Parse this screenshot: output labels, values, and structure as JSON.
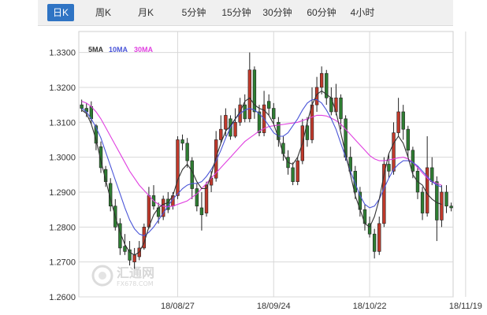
{
  "tabs": [
    {
      "label": "日K",
      "active": true
    },
    {
      "label": "周K",
      "active": false
    },
    {
      "label": "月K",
      "active": false
    },
    {
      "label": "5分钟",
      "active": false
    },
    {
      "label": "15分钟",
      "active": false
    },
    {
      "label": "30分钟",
      "active": false
    },
    {
      "label": "60分钟",
      "active": false
    },
    {
      "label": "4小时",
      "active": false
    }
  ],
  "colors": {
    "up": "#c0392b",
    "down": "#2e7d32",
    "ma5": "#333333",
    "ma10": "#4a55d8",
    "ma30": "#e040e0",
    "grid": "#d8d8d8",
    "tab_active": "#2f74c4"
  },
  "watermark": {
    "name": "汇通网",
    "url": "FX678.COM"
  },
  "chart_data": {
    "type": "candlestick",
    "title": "",
    "legend": [
      {
        "label": "5MA",
        "color": "#333333"
      },
      {
        "label": "10MA",
        "color": "#4a55d8"
      },
      {
        "label": "30MA",
        "color": "#e040e0"
      }
    ],
    "legend_placement": "top-left",
    "grid": true,
    "ylim": [
      1.26,
      1.336
    ],
    "y_ticks": [
      "1.3300",
      "1.3200",
      "1.3100",
      "1.3000",
      "1.2900",
      "1.2800",
      "1.2700",
      "1.2600"
    ],
    "x_ticks": [
      {
        "label": "18/08/27",
        "index": 20
      },
      {
        "label": "18/09/24",
        "index": 40
      },
      {
        "label": "18/10/22",
        "index": 60
      },
      {
        "label": "18/11/19",
        "index": 80
      }
    ],
    "candles": [
      [
        1.315,
        1.314,
        1.3165,
        1.313
      ],
      [
        1.314,
        1.313,
        1.3155,
        1.3115
      ],
      [
        1.3145,
        1.311,
        1.316,
        1.3095
      ],
      [
        1.309,
        1.304,
        1.3095,
        1.302
      ],
      [
        1.303,
        1.297,
        1.3045,
        1.2955
      ],
      [
        1.2965,
        1.293,
        1.2975,
        1.2915
      ],
      [
        1.2925,
        1.286,
        1.294,
        1.2845
      ],
      [
        1.286,
        1.28,
        1.288,
        1.279
      ],
      [
        1.281,
        1.274,
        1.2825,
        1.272
      ],
      [
        1.2745,
        1.273,
        1.278,
        1.272
      ],
      [
        1.2735,
        1.2705,
        1.276,
        1.269
      ],
      [
        1.27,
        1.272,
        1.274,
        1.268
      ],
      [
        1.2715,
        1.274,
        1.276,
        1.2705
      ],
      [
        1.274,
        1.28,
        1.281,
        1.2735
      ],
      [
        1.28,
        1.289,
        1.2915,
        1.2795
      ],
      [
        1.289,
        1.286,
        1.292,
        1.285
      ],
      [
        1.2855,
        1.283,
        1.287,
        1.281
      ],
      [
        1.283,
        1.288,
        1.289,
        1.282
      ],
      [
        1.288,
        1.285,
        1.29,
        1.284
      ],
      [
        1.286,
        1.289,
        1.29,
        1.285
      ],
      [
        1.289,
        1.305,
        1.306,
        1.288
      ],
      [
        1.305,
        1.304,
        1.3065,
        1.302
      ],
      [
        1.304,
        1.299,
        1.3055,
        1.297
      ],
      [
        1.299,
        1.291,
        1.3,
        1.288
      ],
      [
        1.291,
        1.286,
        1.2925,
        1.2845
      ],
      [
        1.2855,
        1.2835,
        1.29,
        1.279
      ],
      [
        1.284,
        1.292,
        1.293,
        1.283
      ],
      [
        1.292,
        1.294,
        1.296,
        1.29
      ],
      [
        1.294,
        1.305,
        1.3075,
        1.293
      ],
      [
        1.305,
        1.308,
        1.312,
        1.304
      ],
      [
        1.308,
        1.312,
        1.314,
        1.306
      ],
      [
        1.311,
        1.306,
        1.312,
        1.305
      ],
      [
        1.306,
        1.31,
        1.314,
        1.3055
      ],
      [
        1.31,
        1.315,
        1.317,
        1.309
      ],
      [
        1.315,
        1.311,
        1.318,
        1.31
      ],
      [
        1.311,
        1.325,
        1.33,
        1.31
      ],
      [
        1.325,
        1.313,
        1.326,
        1.311
      ],
      [
        1.313,
        1.307,
        1.315,
        1.306
      ],
      [
        1.307,
        1.315,
        1.319,
        1.306
      ],
      [
        1.316,
        1.314,
        1.318,
        1.312
      ],
      [
        1.314,
        1.311,
        1.3155,
        1.3095
      ],
      [
        1.31,
        1.305,
        1.3115,
        1.303
      ],
      [
        1.304,
        1.301,
        1.306,
        1.299
      ],
      [
        1.3,
        1.297,
        1.302,
        1.295
      ],
      [
        1.297,
        1.293,
        1.2985,
        1.292
      ],
      [
        1.293,
        1.299,
        1.3,
        1.292
      ],
      [
        1.299,
        1.309,
        1.311,
        1.298
      ],
      [
        1.309,
        1.305,
        1.3115,
        1.303
      ],
      [
        1.305,
        1.315,
        1.32,
        1.304
      ],
      [
        1.315,
        1.32,
        1.323,
        1.313
      ],
      [
        1.32,
        1.324,
        1.326,
        1.318
      ],
      [
        1.324,
        1.317,
        1.325,
        1.315
      ],
      [
        1.317,
        1.313,
        1.32,
        1.312
      ],
      [
        1.313,
        1.317,
        1.321,
        1.312
      ],
      [
        1.317,
        1.311,
        1.318,
        1.308
      ],
      [
        1.311,
        1.3,
        1.312,
        1.299
      ],
      [
        1.3,
        1.296,
        1.303,
        1.295
      ],
      [
        1.296,
        1.29,
        1.2975,
        1.288
      ],
      [
        1.29,
        1.285,
        1.2915,
        1.283
      ],
      [
        1.285,
        1.281,
        1.2865,
        1.279
      ],
      [
        1.281,
        1.278,
        1.283,
        1.277
      ],
      [
        1.278,
        1.273,
        1.2795,
        1.271
      ],
      [
        1.273,
        1.281,
        1.283,
        1.272
      ],
      [
        1.281,
        1.298,
        1.3,
        1.28
      ],
      [
        1.298,
        1.296,
        1.301,
        1.294
      ],
      [
        1.296,
        1.307,
        1.31,
        1.295
      ],
      [
        1.307,
        1.313,
        1.317,
        1.306
      ],
      [
        1.313,
        1.308,
        1.315,
        1.305
      ],
      [
        1.308,
        1.302,
        1.309,
        1.3
      ],
      [
        1.302,
        1.296,
        1.303,
        1.294
      ],
      [
        1.296,
        1.29,
        1.2975,
        1.288
      ],
      [
        1.29,
        1.284,
        1.2915,
        1.282
      ],
      [
        1.284,
        1.297,
        1.306,
        1.283
      ],
      [
        1.297,
        1.293,
        1.3,
        1.292
      ],
      [
        1.293,
        1.282,
        1.2945,
        1.276
      ],
      [
        1.282,
        1.29,
        1.292,
        1.28
      ],
      [
        1.29,
        1.286,
        1.292,
        1.284
      ],
      [
        1.286,
        1.2855,
        1.287,
        1.2845
      ]
    ],
    "ma5": [
      1.3135,
      1.3125,
      1.3095,
      1.305,
      1.299,
      1.2935,
      1.288,
      1.283,
      1.2785,
      1.275,
      1.2728,
      1.272,
      1.2728,
      1.2755,
      1.28,
      1.2835,
      1.2855,
      1.2865,
      1.287,
      1.289,
      1.2935,
      1.2965,
      1.298,
      1.296,
      1.293,
      1.291,
      1.291,
      1.295,
      1.3,
      1.304,
      1.3075,
      1.309,
      1.311,
      1.313,
      1.316,
      1.317,
      1.315,
      1.314,
      1.3135,
      1.312,
      1.3095,
      1.3055,
      1.301,
      1.2985,
      1.298,
      1.3,
      1.304,
      1.31,
      1.315,
      1.318,
      1.319,
      1.318,
      1.317,
      1.313,
      1.307,
      1.301,
      1.295,
      1.289,
      1.285,
      1.281,
      1.28,
      1.283,
      1.288,
      1.295,
      1.301,
      1.304,
      1.306,
      1.304,
      1.3,
      1.295,
      1.293,
      1.292,
      1.2895,
      1.288,
      1.287,
      1.2865
    ],
    "ma10": [
      1.314,
      1.313,
      1.311,
      1.3085,
      1.3055,
      1.3015,
      1.2975,
      1.2935,
      1.2895,
      1.2855,
      1.282,
      1.2795,
      1.278,
      1.2775,
      1.2785,
      1.28,
      1.282,
      1.284,
      1.286,
      1.288,
      1.2895,
      1.291,
      1.292,
      1.2925,
      1.2925,
      1.293,
      1.2945,
      1.2965,
      1.299,
      1.302,
      1.3055,
      1.3085,
      1.311,
      1.3125,
      1.3135,
      1.314,
      1.3135,
      1.3125,
      1.311,
      1.309,
      1.307,
      1.306,
      1.306,
      1.307,
      1.309,
      1.311,
      1.3135,
      1.3155,
      1.3165,
      1.3165,
      1.3155,
      1.3135,
      1.311,
      1.308,
      1.304,
      1.3,
      1.296,
      1.2925,
      1.289,
      1.2865,
      1.2855,
      1.286,
      1.288,
      1.291,
      1.294,
      1.2965,
      1.298,
      1.299,
      1.299,
      1.2985,
      1.2975,
      1.296,
      1.2945,
      1.293,
      1.292,
      1.2915
    ],
    "ma30": [
      1.316,
      1.3155,
      1.3145,
      1.313,
      1.311,
      1.3085,
      1.306,
      1.3035,
      1.301,
      1.2985,
      1.296,
      1.294,
      1.292,
      1.2905,
      1.289,
      1.2875,
      1.2865,
      1.286,
      1.2858,
      1.286,
      1.2865,
      1.287,
      1.2875,
      1.2885,
      1.2895,
      1.291,
      1.2925,
      1.294,
      1.2955,
      1.297,
      1.2985,
      1.3,
      1.3015,
      1.303,
      1.3045,
      1.3055,
      1.3065,
      1.3075,
      1.3082,
      1.3088,
      1.309,
      1.3092,
      1.3094,
      1.3096,
      1.3098,
      1.31,
      1.3105,
      1.311,
      1.3115,
      1.312,
      1.312,
      1.3118,
      1.3112,
      1.3105,
      1.3095,
      1.308,
      1.3065,
      1.305,
      1.3035,
      1.302,
      1.3005,
      1.2995,
      1.299,
      1.299,
      1.2992,
      1.2995,
      1.2998,
      1.3,
      1.2995,
      1.2985,
      1.297,
      1.2955,
      1.294,
      1.293,
      1.2925,
      1.292
    ]
  }
}
